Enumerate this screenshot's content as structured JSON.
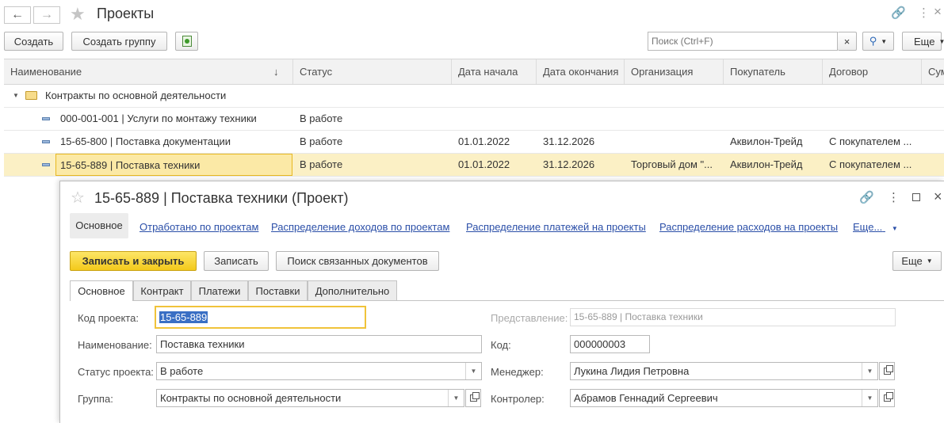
{
  "window": {
    "title": "Проекты"
  },
  "toolbar": {
    "create_label": "Создать",
    "create_group_label": "Создать группу",
    "search_placeholder": "Поиск (Ctrl+F)",
    "search_clear": "×",
    "more_label": "Еще"
  },
  "table": {
    "columns": [
      "Наименование",
      "Статус",
      "Дата начала",
      "Дата окончания",
      "Организация",
      "Покупатель",
      "Договор",
      "Сум"
    ],
    "sort_indicator": "↓",
    "group_row": {
      "name": "Контракты по основной деятельности"
    },
    "rows": [
      {
        "name": "000-001-001 | Услуги по монтажу техники",
        "status": "В работе",
        "start": "",
        "end": "",
        "org": "",
        "buyer": "",
        "contract": ""
      },
      {
        "name": "15-65-800 | Поставка документации",
        "status": "В работе",
        "start": "01.01.2022",
        "end": "31.12.2026",
        "org": "",
        "buyer": "Аквилон-Трейд",
        "contract": "С покупателем ..."
      },
      {
        "name": "15-65-889 | Поставка техники",
        "status": "В работе",
        "start": "01.01.2022",
        "end": "31.12.2026",
        "org": "Торговый дом \"...",
        "buyer": "Аквилон-Трейд",
        "contract": "С покупателем ..."
      }
    ]
  },
  "form": {
    "title": "15-65-889 | Поставка техники (Проект)",
    "nav": {
      "main": "Основное",
      "links": [
        "Отработано по проектам",
        "Распределение доходов по проектам",
        "Распределение платежей на проекты",
        "Распределение расходов на проекты"
      ],
      "more": "Еще..."
    },
    "buttons": {
      "save_close": "Записать и закрыть",
      "save": "Записать",
      "search_docs": "Поиск связанных документов",
      "more": "Еще"
    },
    "tabs": [
      "Основное",
      "Контракт",
      "Платежи",
      "Поставки",
      "Дополнительно"
    ],
    "fields": {
      "code_label": "Код проекта:",
      "code_value": "15-65-889",
      "repr_label": "Представление:",
      "repr_value": "15-65-889 | Поставка техники",
      "name_label": "Наименование:",
      "name_value": "Поставка техники",
      "kod_label": "Код:",
      "kod_value": "000000003",
      "status_label": "Статус проекта:",
      "status_value": "В работе",
      "manager_label": "Менеджер:",
      "manager_value": "Лукина Лидия Петровна",
      "group_label": "Группа:",
      "group_value": "Контракты по основной деятельности",
      "controller_label": "Контролер:",
      "controller_value": "Абрамов Геннадий Сергеевич"
    }
  },
  "colors": {
    "accent_yellow": "#f8d63a",
    "selected_row": "#fbf0c5",
    "link": "#2b4fa8"
  }
}
